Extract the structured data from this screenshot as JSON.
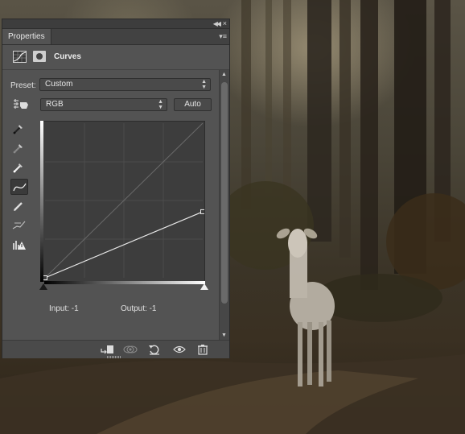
{
  "panel": {
    "tab_label": "Properties",
    "title": "Curves",
    "collapse_icon": "double-chevron-right-icon",
    "close_icon": "close-icon",
    "menu_icon": "panel-menu-icon"
  },
  "preset": {
    "label": "Preset:",
    "value": "Custom"
  },
  "channel": {
    "value": "RGB"
  },
  "auto_label": "Auto",
  "tools": [
    "on-image-adjustment-icon",
    "black-point-eyedropper-icon",
    "gray-point-eyedropper-icon",
    "white-point-eyedropper-icon",
    "curve-points-icon",
    "pencil-draw-icon",
    "smooth-curve-icon",
    "clipping-warning-icon"
  ],
  "curve": {
    "points": [
      {
        "input": 0,
        "output": 0
      },
      {
        "input": 255,
        "output": 109
      }
    ]
  },
  "io": {
    "input_text": "Input:  -1",
    "output_text": "Output:  -1"
  },
  "footer_icons": [
    "clip-to-layer-icon",
    "view-previous-state-icon",
    "reset-icon",
    "visibility-eye-icon",
    "trash-icon"
  ],
  "colors": {
    "panel_bg": "#535353",
    "graph_bg": "#3d3d3d",
    "curve": "#e8e8e8"
  }
}
